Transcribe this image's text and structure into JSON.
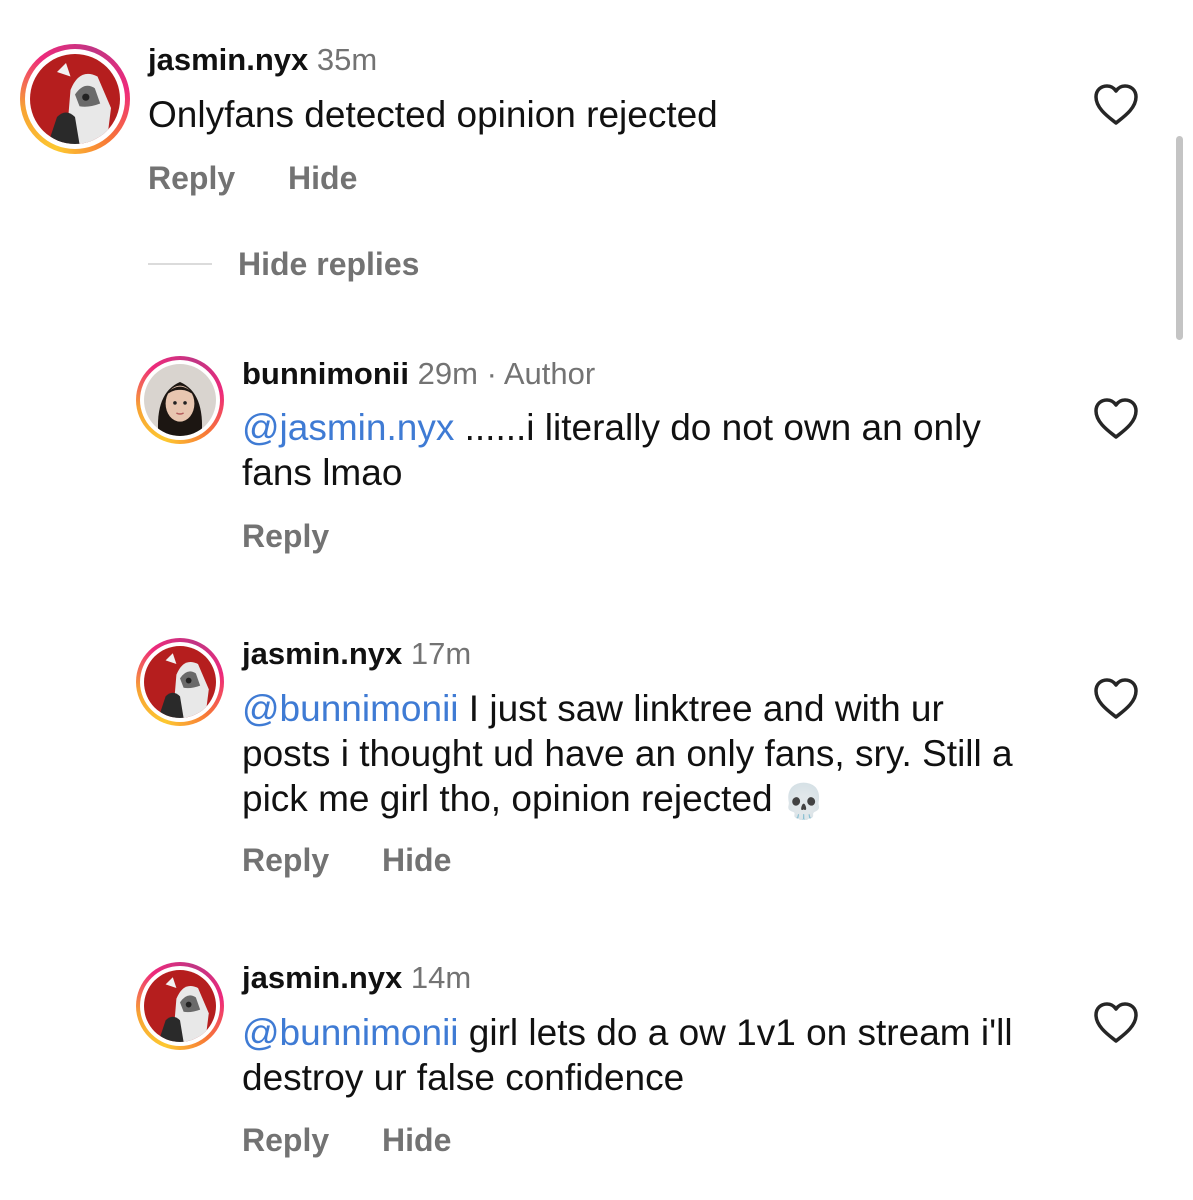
{
  "comments": [
    {
      "username": "jasmin.nyx",
      "time": "35m",
      "author_label": "",
      "mention": "",
      "text": "Onlyfans detected opinion rejected",
      "emoji": "",
      "actions": [
        "Reply",
        "Hide"
      ],
      "avatar": "anime-avatar"
    },
    {
      "username": "bunnimonii",
      "time": "29m",
      "author_label": "· Author",
      "mention": "@jasmin.nyx",
      "text": " ......i literally do not own an only fans lmao",
      "emoji": "",
      "actions": [
        "Reply"
      ],
      "avatar": "photo-avatar"
    },
    {
      "username": "jasmin.nyx",
      "time": "17m",
      "author_label": "",
      "mention": "@bunnimonii",
      "text": " I just saw linktree and with ur posts i thought ud have an only fans, sry. Still a pick me girl tho, opinion rejected",
      "emoji": "💀",
      "actions": [
        "Reply",
        "Hide"
      ],
      "avatar": "anime-avatar"
    },
    {
      "username": "jasmin.nyx",
      "time": "14m",
      "author_label": "",
      "mention": "@bunnimonii",
      "text": " girl lets do a ow 1v1 on stream i'll destroy ur false confidence",
      "emoji": "",
      "actions": [
        "Reply",
        "Hide"
      ],
      "avatar": "anime-avatar"
    }
  ],
  "hide_replies_label": "Hide replies",
  "icons": {
    "like": "heart-outline-icon"
  },
  "colors": {
    "mention": "#3f7bd4",
    "secondary_text": "#737373",
    "ring_start": "#fdc830",
    "ring_end": "#ee2a7b"
  }
}
